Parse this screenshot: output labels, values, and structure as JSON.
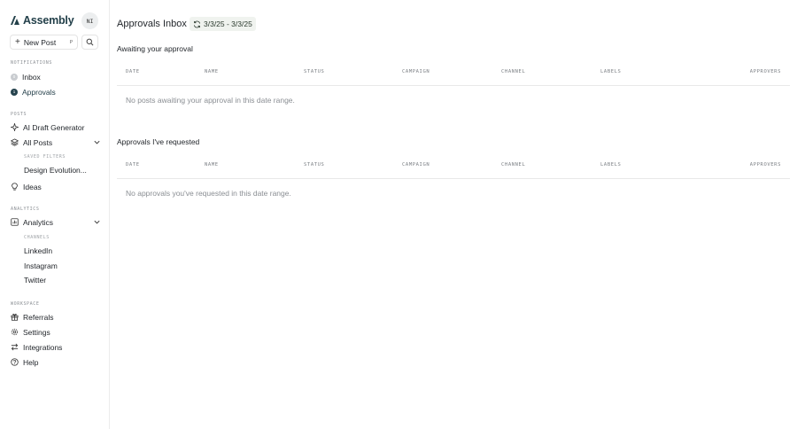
{
  "brand": {
    "name": "Assembly"
  },
  "user": {
    "initials": "NI"
  },
  "toolbar": {
    "new_post_label": "New Post",
    "new_post_shortcut": "P"
  },
  "sidebar": {
    "notifications": {
      "title": "NOTIFICATIONS",
      "inbox": {
        "label": "Inbox",
        "count": "0"
      },
      "approvals": {
        "label": "Approvals",
        "count": "1"
      }
    },
    "posts": {
      "title": "POSTS",
      "ai_draft": "AI Draft Generator",
      "all_posts": "All Posts",
      "saved_filters_title": "SAVED FILTERS",
      "saved_filter_1": "Design Evolution..."
    },
    "ideas": "Ideas",
    "analytics": {
      "title": "ANALYTICS",
      "label": "Analytics",
      "channels_title": "CHANNELS",
      "linkedin": "LinkedIn",
      "instagram": "Instagram",
      "twitter": "Twitter"
    },
    "workspace": {
      "title": "WORKSPACE",
      "referrals": "Referrals",
      "settings": "Settings",
      "integrations": "Integrations",
      "help": "Help"
    }
  },
  "main": {
    "title": "Approvals Inbox",
    "date_range": "3/3/25 - 3/3/25",
    "columns": [
      "DATE",
      "NAME",
      "STATUS",
      "CAMPAIGN",
      "CHANNEL",
      "LABELS",
      "APPROVERS"
    ],
    "awaiting": {
      "heading": "Awaiting your approval",
      "empty": "No posts awaiting your approval in this date range."
    },
    "requested": {
      "heading": "Approvals I've requested",
      "empty": "No approvals you've requested in this date range."
    }
  },
  "colors": {
    "brand": "#23404a",
    "accent_dark": "#26434e",
    "date_bg": "#f0f3ef"
  }
}
